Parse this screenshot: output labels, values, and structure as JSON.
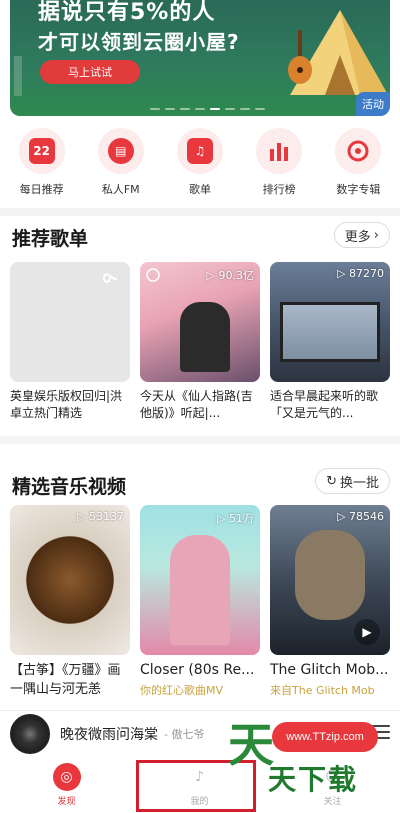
{
  "banner": {
    "headline_1": "据说只有5%的人",
    "headline_2": "才可以领到云圈小屋?",
    "cta": "马上试试",
    "tag": "活动"
  },
  "quick_nav": [
    {
      "label": "每日推荐",
      "icon": "calendar-icon",
      "glyph": "22"
    },
    {
      "label": "私人FM",
      "icon": "radio-icon",
      "glyph": "📻"
    },
    {
      "label": "歌单",
      "icon": "playlist-icon",
      "glyph": "♫"
    },
    {
      "label": "排行榜",
      "icon": "chart-icon",
      "glyph": "▮"
    },
    {
      "label": "数字专辑",
      "icon": "album-icon",
      "glyph": "◉"
    }
  ],
  "playlists": {
    "title": "推荐歌单",
    "more": "更多",
    "items": [
      {
        "title": "英皇娱乐版权回归|洪卓立热门精选",
        "plays": ""
      },
      {
        "title": "今天从《仙人指路(吉他版)》听起|...",
        "plays": "▷ 90.3亿"
      },
      {
        "title": "适合早晨起来听的歌「又是元气的...",
        "plays": "▷ 87270"
      }
    ]
  },
  "videos": {
    "title": "精选音乐视频",
    "refresh": "换一批",
    "items": [
      {
        "title": "【古筝】《万疆》画一隅山与河无恙",
        "plays": "▷ 53137",
        "sub": ""
      },
      {
        "title": "Closer (80s Re...",
        "plays": "▷ 51万",
        "sub": "你的红心歌曲MV"
      },
      {
        "title": "The Glitch Mob...",
        "plays": "▷ 78546",
        "sub": "来自The Glitch Mob"
      }
    ]
  },
  "player": {
    "title": "晚夜微雨问海棠",
    "artist": "- 傲七爷"
  },
  "tabs": [
    {
      "label": "发现",
      "icon": "discover-icon",
      "glyph": "◎"
    },
    {
      "label": "我的",
      "icon": "music-note-icon",
      "glyph": "♪"
    },
    {
      "label": "关注",
      "icon": "follow-icon",
      "glyph": "☺"
    }
  ],
  "watermark": {
    "url": "www.TTzip.com",
    "text": "天下载"
  },
  "colors": {
    "accent": "#e8383d",
    "highlight_box": "#d11f2d"
  }
}
